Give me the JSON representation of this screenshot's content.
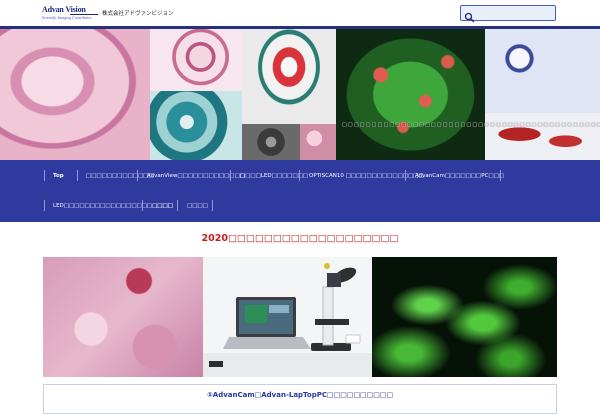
{
  "header": {
    "logo": {
      "mark": "Advan Vision",
      "tagline": "Scientific Imaging Contributor",
      "company_jp": "株式会社アドヴァンビジョン"
    },
    "search": {
      "placeholder": "",
      "value": ""
    }
  },
  "hero": {
    "caption": "□□□□□□□□□□□□□□□□□□□□□□□□□□□□□□□□□□□□□□□□□□□□□□□□□"
  },
  "nav": {
    "items": [
      {
        "label": "Top"
      },
      {
        "label": "□□□□□□□□□□□□□"
      },
      {
        "label": "AdvanView□□□□□□□□□□□□□"
      },
      {
        "label": "□□□□LED□□□□□□□"
      },
      {
        "label": "OPTISCAN10 □□□□□□□□□□□□□□□"
      },
      {
        "label": "AdvanCam□□□□□□□PC□□□"
      },
      {
        "label": "LED□□□□□□□□□□□□□□□□□□□□□"
      },
      {
        "label": "□□□□"
      },
      {
        "label": "□□□□"
      }
    ]
  },
  "main": {
    "section_title": "2020□□□□□□□□□□□□□□□□□□□",
    "card_title": "①AdvanCam□Advan-LapTopPC□□□□□□□□□□"
  },
  "colors": {
    "nav_bg": "#2e3a9e",
    "header_rule": "#27307f",
    "section_title": "#c71c1c",
    "card_title": "#2a35a0"
  }
}
